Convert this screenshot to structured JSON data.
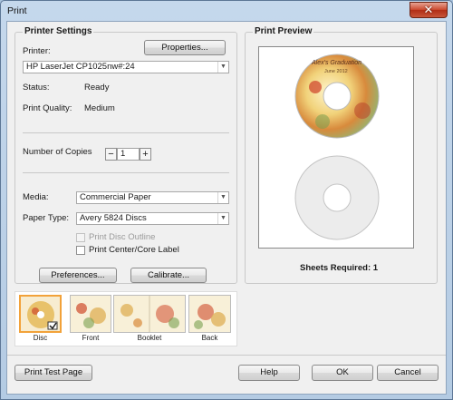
{
  "window": {
    "title": "Print",
    "close_glyph": "✕"
  },
  "printer_settings": {
    "group_label": "Printer Settings",
    "printer_label": "Printer:",
    "properties_button": "Properties...",
    "printer_value": "HP LaserJet CP1025nw#:24",
    "status_label": "Status:",
    "status_value": "Ready",
    "quality_label": "Print Quality:",
    "quality_value": "Medium",
    "copies_label": "Number of Copies",
    "copies_value": "1",
    "media_label": "Media:",
    "media_value": "Commercial Paper",
    "paper_type_label": "Paper Type:",
    "paper_type_value": "Avery 5824 Discs",
    "disc_outline_label": "Print Disc Outline",
    "disc_outline_checked": false,
    "center_label": "Print Center/Core Label",
    "center_checked": false,
    "preferences_button": "Preferences...",
    "calibrate_button": "Calibrate..."
  },
  "print_preview": {
    "group_label": "Print Preview",
    "disc_title": "Alex's Graduation",
    "disc_subtitle": "June 2012",
    "sheets_required": "Sheets Required: 1"
  },
  "thumbnails": [
    {
      "label": "Disc",
      "selected": true
    },
    {
      "label": "Front",
      "selected": false
    },
    {
      "label": "Booklet",
      "selected": false
    },
    {
      "label": "Back",
      "selected": false
    }
  ],
  "footer": {
    "print_test_page": "Print Test Page",
    "help": "Help",
    "ok": "OK",
    "cancel": "Cancel"
  },
  "colors": {
    "accent": "#f2a23a",
    "close_red": "#c8553a"
  },
  "icons": [
    "close-icon",
    "dropdown-arrow-icon",
    "check-mark-icon",
    "minus-icon",
    "plus-icon"
  ]
}
